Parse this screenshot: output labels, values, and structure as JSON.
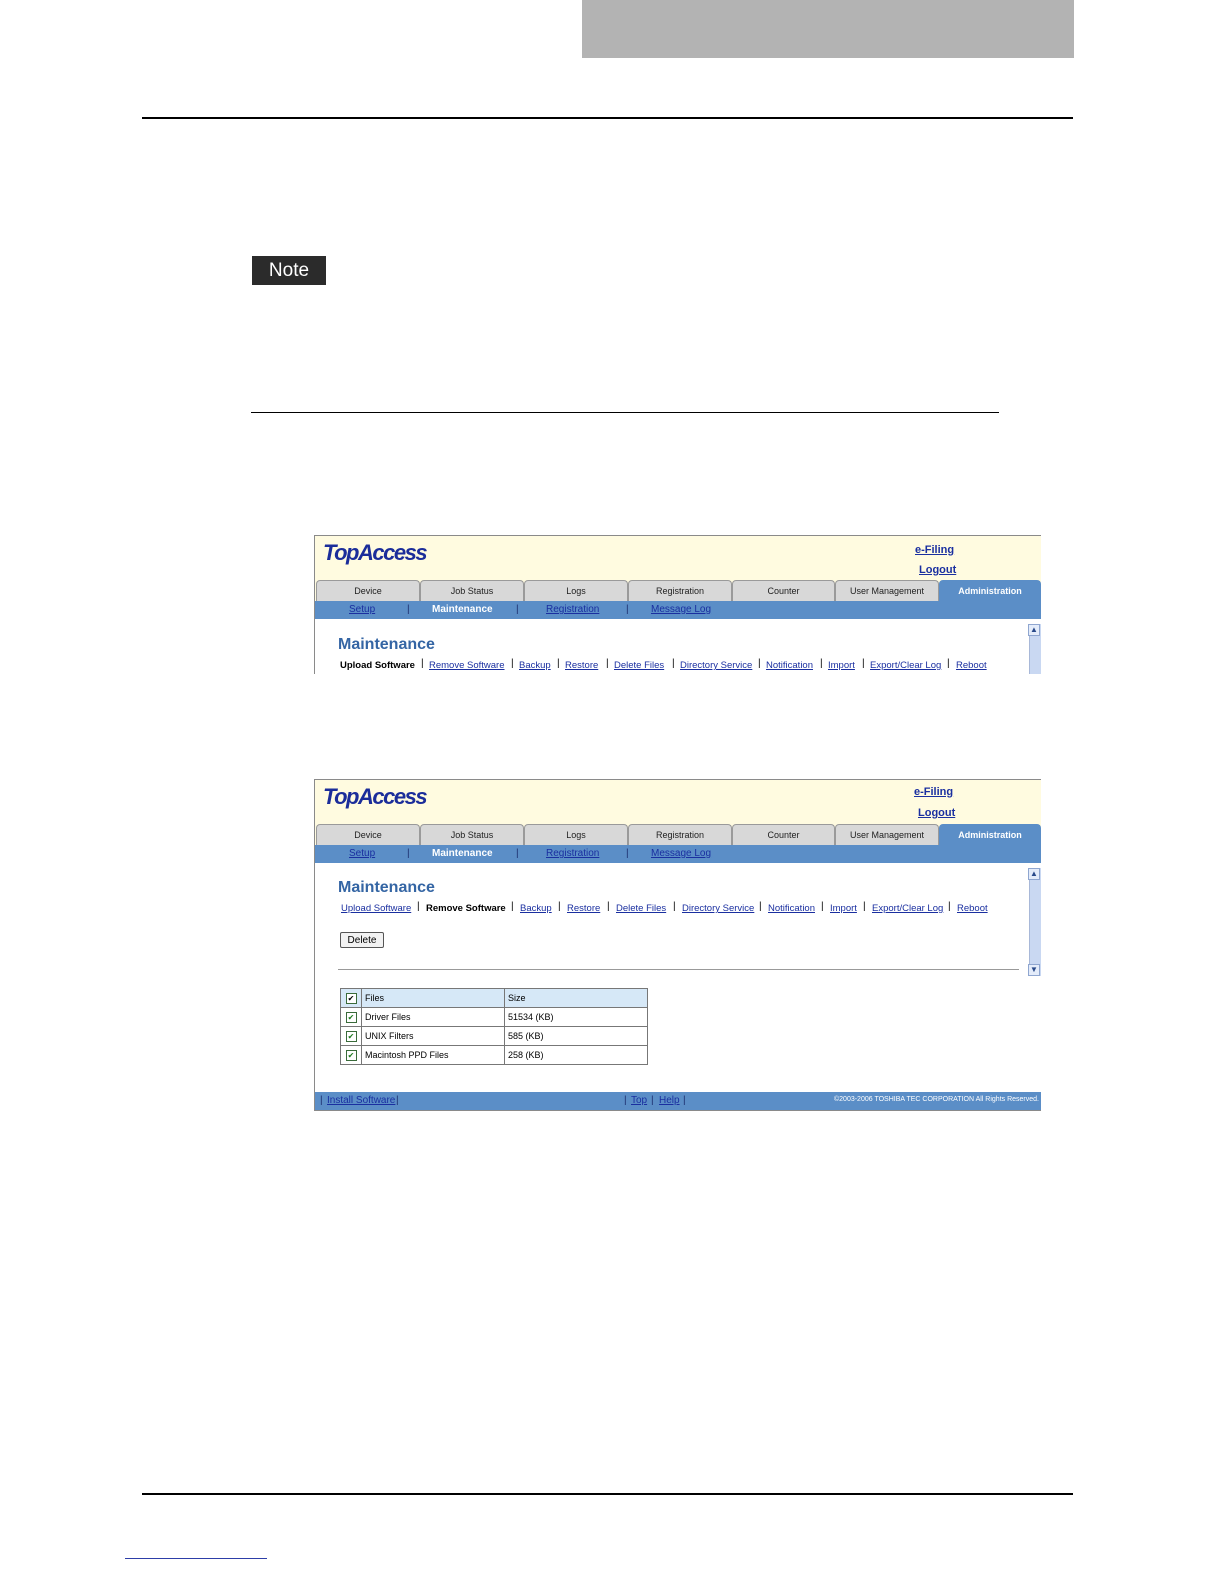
{
  "page": {
    "note_label": "Note"
  },
  "app": {
    "logo": "TopAccess",
    "efiling_link": "e-Filing",
    "logout_link": "Logout",
    "tabs": [
      "Device",
      "Job Status",
      "Logs",
      "Registration",
      "Counter",
      "User Management",
      "Administration"
    ],
    "active_tab": "Administration",
    "subnav": [
      "Setup",
      "Maintenance",
      "Registration",
      "Message Log"
    ],
    "active_subnav": "Maintenance",
    "page_title": "Maintenance",
    "maintenance_menu": [
      "Upload Software",
      "Remove Software",
      "Backup",
      "Restore",
      "Delete Files",
      "Directory Service",
      "Notification",
      "Import",
      "Export/Clear Log",
      "Reboot"
    ]
  },
  "screen1": {
    "active_menu": "Upload Software"
  },
  "screen2": {
    "active_menu": "Remove Software",
    "delete_button": "Delete",
    "table": {
      "headers": [
        "Files",
        "Size"
      ],
      "rows": [
        {
          "name": "Driver Files",
          "size": "51534 (KB)",
          "checked": true
        },
        {
          "name": "UNIX Filters",
          "size": "585 (KB)",
          "checked": true
        },
        {
          "name": "Macintosh PPD Files",
          "size": "258 (KB)",
          "checked": true
        }
      ]
    },
    "footer": {
      "install_software": "Install Software",
      "top": "Top",
      "help": "Help",
      "copyright": "©2003-2006 TOSHIBA TEC CORPORATION All Rights Reserved."
    }
  },
  "colors": {
    "nav_blue": "#5b8ec7",
    "header_yellow": "#fffbe0",
    "link_blue": "#1a2fa0",
    "title_blue": "#3465a4"
  }
}
